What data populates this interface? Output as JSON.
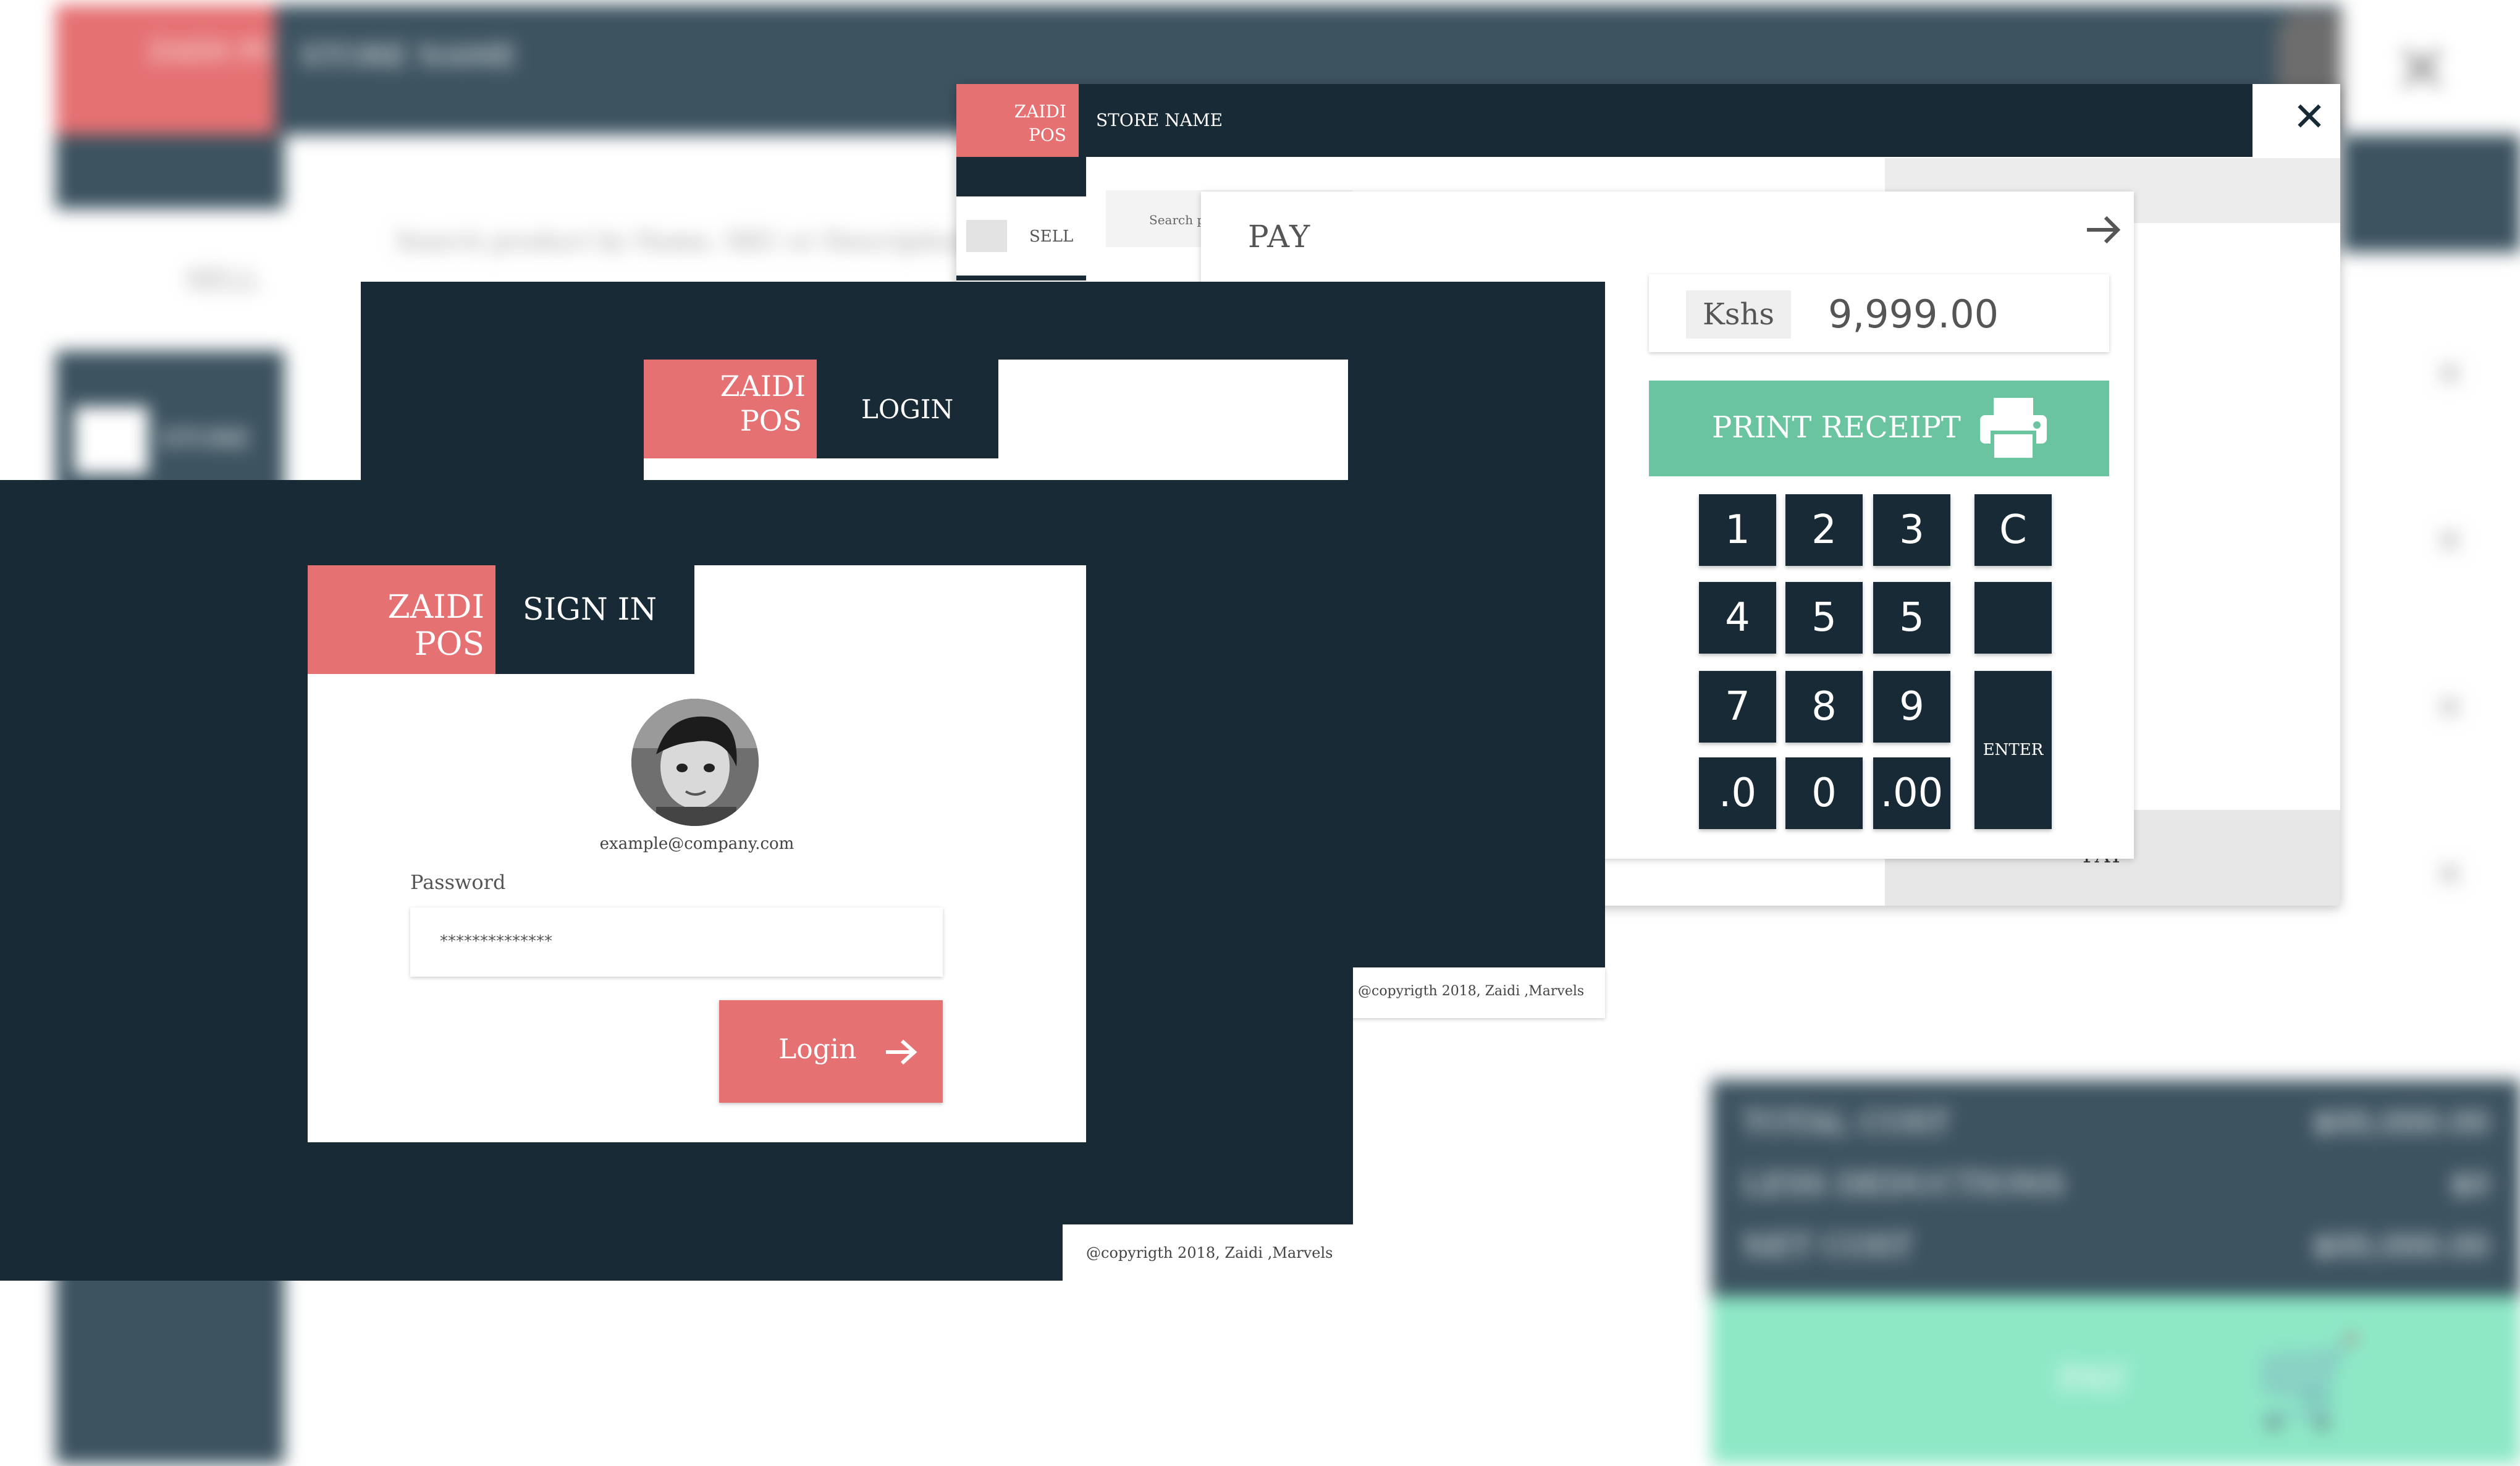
{
  "background_app": {
    "brand": "ZAIDI POS",
    "store_name": "STORE NAME",
    "search_placeholder": "Search product by Name, SKU or Description",
    "sell_label": "SELL",
    "store_label": "STORE",
    "summary": [
      {
        "label": "TOTAL COST",
        "value": "$00,000.00"
      },
      {
        "label": "LESS DEDUCTIONS",
        "value": "$0"
      },
      {
        "label": "NET COST",
        "value": "$00,000.00"
      }
    ],
    "pay_button": "PAY"
  },
  "pos_window": {
    "brand_line1": "ZAIDI",
    "brand_line2": "POS",
    "store_name": "STORE NAME",
    "sell_label": "SELL",
    "search_placeholder": "Search p",
    "pay_under": "PAY"
  },
  "pay_dialog": {
    "title": "PAY",
    "currency": "Kshs",
    "amount": "9,999.00",
    "print_receipt": "PRINT RECEIPT",
    "keys": [
      "1",
      "2",
      "3",
      "C",
      "4",
      "5",
      "5",
      "",
      "7",
      "8",
      "9",
      ".0",
      "0",
      ".00"
    ],
    "enter": "ENTER"
  },
  "login_window": {
    "brand_line1": "ZAIDI",
    "brand_line2": "POS",
    "title": "LOGIN",
    "copyright": "@copyrigth 2018, Zaidi ,Marvels"
  },
  "signin_window": {
    "brand_line1": "ZAIDI",
    "brand_line2": "POS",
    "title": "SIGN IN",
    "email": "example@company.com",
    "password_label": "Password",
    "password_value": "**************",
    "login_button": "Login",
    "copyright": "@copyrigth 2018, Zaidi ,Marvels"
  },
  "colors": {
    "dark": "#182a36",
    "coral": "#e57173",
    "green": "#6bc4a0",
    "mint": "#8de8c6"
  }
}
